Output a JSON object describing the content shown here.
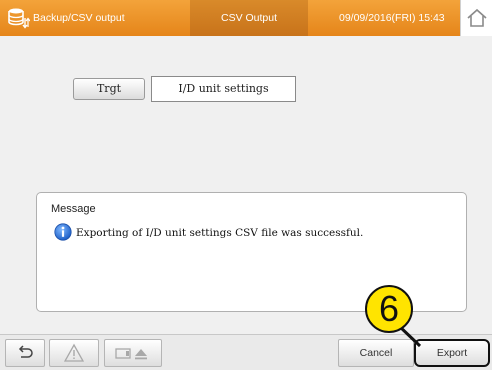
{
  "header": {
    "title": "Backup/CSV output",
    "tab_label": "CSV Output",
    "datetime": "09/09/2016(FRI) 15:43",
    "colors": {
      "bar": "#e8901f"
    }
  },
  "main": {
    "target_button_label": "Trgt",
    "target_value": "I/D unit settings"
  },
  "message": {
    "title": "Message",
    "text": "Exporting of I/D unit settings CSV file was successful.",
    "icon": "info-icon"
  },
  "footer": {
    "cancel_label": "Cancel",
    "export_label": "Export"
  },
  "callout": {
    "number": "6"
  }
}
